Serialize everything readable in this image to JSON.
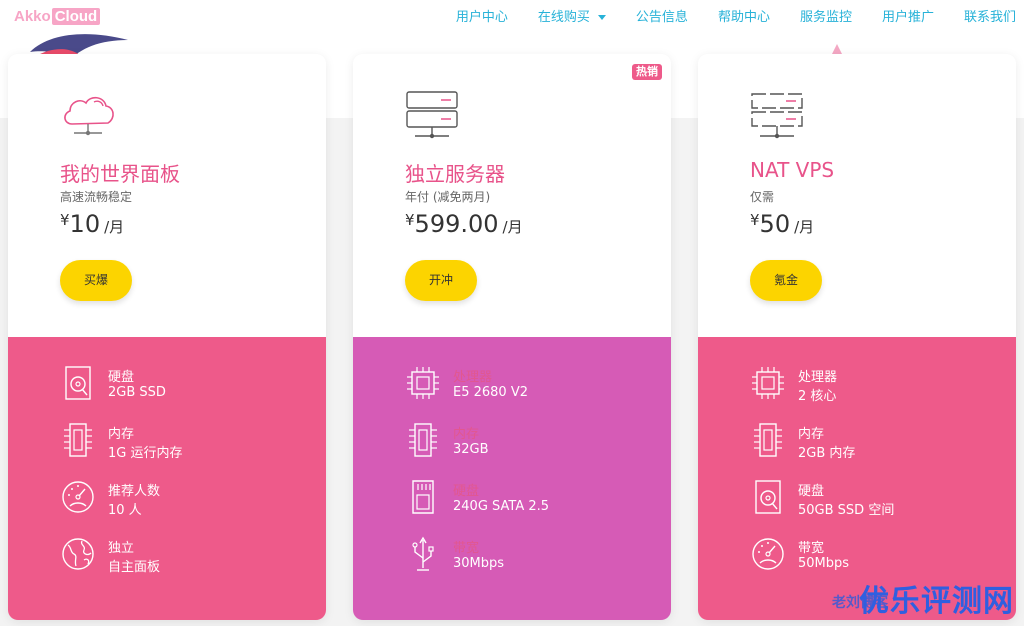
{
  "logo": {
    "part1": "Akko",
    "part2": "Cloud"
  },
  "nav": {
    "items": [
      {
        "label": "用户中心"
      },
      {
        "label": "在线购买"
      },
      {
        "label": "公告信息"
      },
      {
        "label": "帮助中心"
      },
      {
        "label": "服务监控"
      },
      {
        "label": "用户推广"
      },
      {
        "label": "联系我们"
      }
    ]
  },
  "plans": [
    {
      "name": "我的世界面板",
      "subtitle": "高速流畅稳定",
      "currency": "¥",
      "price": "10",
      "period": "/月",
      "button": "买爆",
      "icon": "cloud-icon",
      "specs": [
        {
          "label": "硬盘",
          "value": "2GB SSD",
          "icon": "disk-icon"
        },
        {
          "label": "内存",
          "value": "1G 运行内存",
          "icon": "memory-icon"
        },
        {
          "label": "推荐人数",
          "value": "10 人",
          "icon": "gauge-icon"
        },
        {
          "label": "独立",
          "value": "自主面板",
          "icon": "globe-icon"
        }
      ]
    },
    {
      "name": "独立服务器",
      "subtitle": "年付 (减免两月)",
      "currency": "¥",
      "price": "599.00",
      "period": "/月",
      "button": "开冲",
      "badge": "热销",
      "icon": "server-icon",
      "specs": [
        {
          "label": "处理器",
          "value": "E5 2680 V2",
          "icon": "cpu-icon"
        },
        {
          "label": "内存",
          "value": "32GB",
          "icon": "memory-icon"
        },
        {
          "label": "硬盘",
          "value": "240G SATA 2.5",
          "icon": "sd-card-icon"
        },
        {
          "label": "带宽",
          "value": "30Mbps",
          "icon": "usb-icon"
        }
      ]
    },
    {
      "name": "NAT VPS",
      "subtitle": "仅需",
      "currency": "¥",
      "price": "50",
      "period": "/月",
      "button": "氪金",
      "icon": "server-icon",
      "specs": [
        {
          "label": "处理器",
          "value": "2 核心",
          "icon": "cpu-icon"
        },
        {
          "label": "内存",
          "value": "2GB 内存",
          "icon": "memory-icon"
        },
        {
          "label": "硬盘",
          "value": "50GB SSD 空间",
          "icon": "disk-icon"
        },
        {
          "label": "带宽",
          "value": "50Mbps",
          "icon": "gauge-icon"
        }
      ]
    }
  ],
  "watermark": {
    "small": "老刘博客",
    "big": "优乐评测网"
  },
  "colors": {
    "nav": "#27b2d8",
    "pink": "#ee5a8a",
    "purple": "#d65bb6",
    "button": "#fcd400",
    "title": "#e8538a"
  }
}
